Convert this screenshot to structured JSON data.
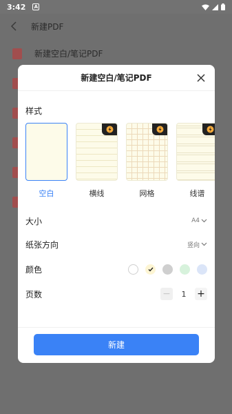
{
  "status_bar": {
    "time": "3:42",
    "badge": "A"
  },
  "app_bar": {
    "title": "新建PDF"
  },
  "background_list": [
    {
      "label": "新建空白/笔记PDF",
      "icon": "pdf-file-icon"
    },
    {
      "label": "",
      "icon": "pdf-file-icon"
    },
    {
      "label": "",
      "icon": "pdf-file-icon"
    },
    {
      "label": "",
      "icon": "pdf-file-icon"
    },
    {
      "label": "",
      "icon": "pdf-file-icon"
    },
    {
      "label": "",
      "icon": "pdf-file-icon"
    }
  ],
  "dialog": {
    "title": "新建空白/笔记PDF",
    "style_label": "样式",
    "styles": [
      {
        "name": "空白",
        "pattern": "blank",
        "selected": true,
        "vip": false
      },
      {
        "name": "横线",
        "pattern": "lined",
        "selected": false,
        "vip": true
      },
      {
        "name": "网格",
        "pattern": "grid",
        "selected": false,
        "vip": true
      },
      {
        "name": "线谱",
        "pattern": "staff",
        "selected": false,
        "vip": true
      }
    ],
    "size": {
      "label": "大小",
      "value": "A4"
    },
    "orientation": {
      "label": "纸张方向",
      "value": "竖向"
    },
    "color": {
      "label": "颜色",
      "options": [
        "#ffffff",
        "#fdf5d3",
        "#cfcfcf",
        "#d7f2dc",
        "#dbe5f8"
      ],
      "selected_index": 1
    },
    "pages": {
      "label": "页数",
      "value": "1",
      "minus": "−",
      "plus": "+"
    },
    "create_label": "新建"
  },
  "colors": {
    "accent": "#3a82f6",
    "overlay": "#6f6f6f"
  }
}
